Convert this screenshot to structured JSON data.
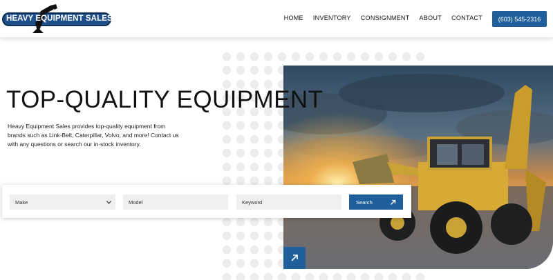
{
  "header": {
    "logo_text": "HEAVY EQUIPMENT SALES",
    "nav": [
      "HOME",
      "INVENTORY",
      "CONSIGNMENT",
      "ABOUT",
      "CONTACT"
    ],
    "phone": "(603) 545-2316"
  },
  "hero": {
    "title": "TOP-QUALITY EQUIPMENT",
    "description": "Heavy Equipment Sales provides top-quality equipment from brands such as Link-Belt, Caterpillar, Volvo, and more! Contact us with any questions or search our in-stock inventory."
  },
  "search": {
    "make_value": "Make",
    "model_placeholder": "Model",
    "keyword_placeholder": "Keyword",
    "button_label": "Search"
  },
  "colors": {
    "brand_blue": "#1f5f9c",
    "logo_blue": "#1f4f8a"
  },
  "icons": {
    "search_button": "arrow-up-right-icon",
    "image_corner": "arrow-up-right-icon",
    "make_select": "chevron-down-icon"
  }
}
